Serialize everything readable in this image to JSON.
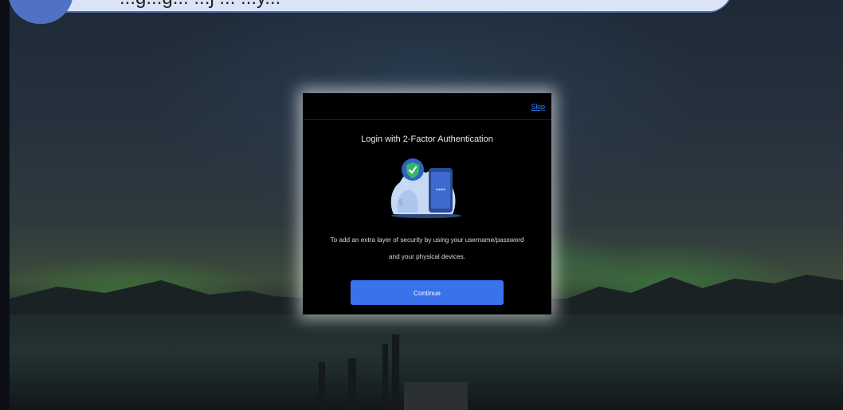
{
  "top_banner": {
    "text": "...g...g... ...ʃ ... ...y..."
  },
  "modal": {
    "skip_label": "Skip",
    "title": "Login with 2-Factor Authentication",
    "description_line1": "To add an extra layer of security by using your username/password",
    "description_line2": "and your physical devices.",
    "phone_mask": "****",
    "continue_label": "Continue"
  },
  "colors": {
    "accent": "#3a72ec",
    "link": "#3b82f6",
    "modal_bg": "#000000",
    "banner_bg": "#dbe4f7",
    "badge": "#4f72c4"
  },
  "icons": [
    "shield-check-icon",
    "phone-icon",
    "cloud-illustration"
  ]
}
